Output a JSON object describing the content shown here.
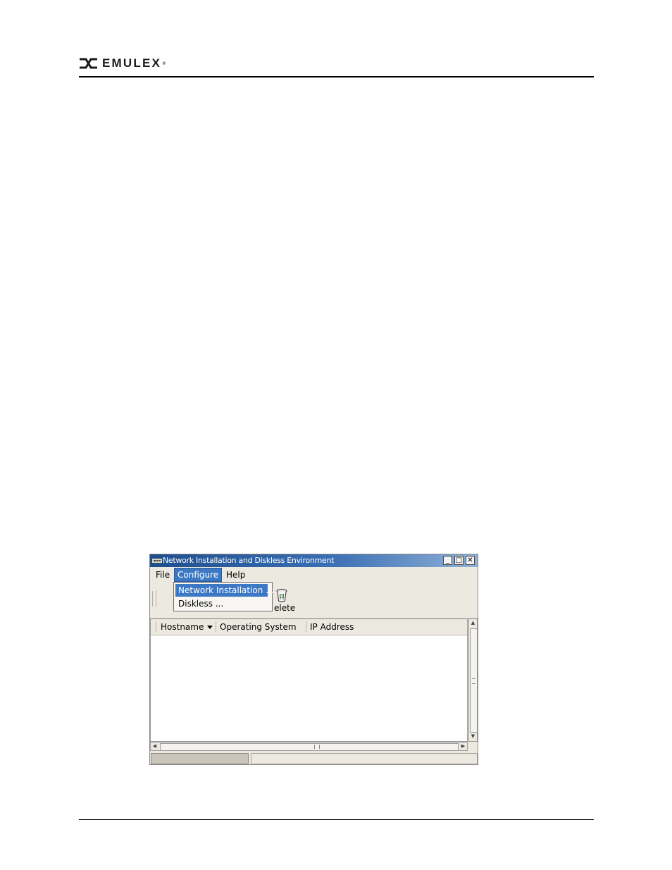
{
  "header": {
    "logo_text": "EMULEX",
    "logo_icon": "emulex-logo-icon"
  },
  "window": {
    "title": "Network Installation and Diskless Environment",
    "controls": {
      "minimize": "_",
      "maximize": "□",
      "close": "✕"
    },
    "menu": {
      "file": "File",
      "configure": "Configure",
      "help": "Help"
    },
    "dropdown": {
      "items": [
        "Network Installation ...",
        "Diskless ..."
      ]
    },
    "toolbar": {
      "delete_label": "elete",
      "partial_label": "'"
    },
    "table": {
      "columns": [
        "Hostname",
        "Operating System",
        "IP Address"
      ]
    }
  },
  "colors": {
    "titlebar": "#1f4e8c",
    "menu_highlight": "#3d78c4",
    "window_bg": "#ece9e0"
  }
}
